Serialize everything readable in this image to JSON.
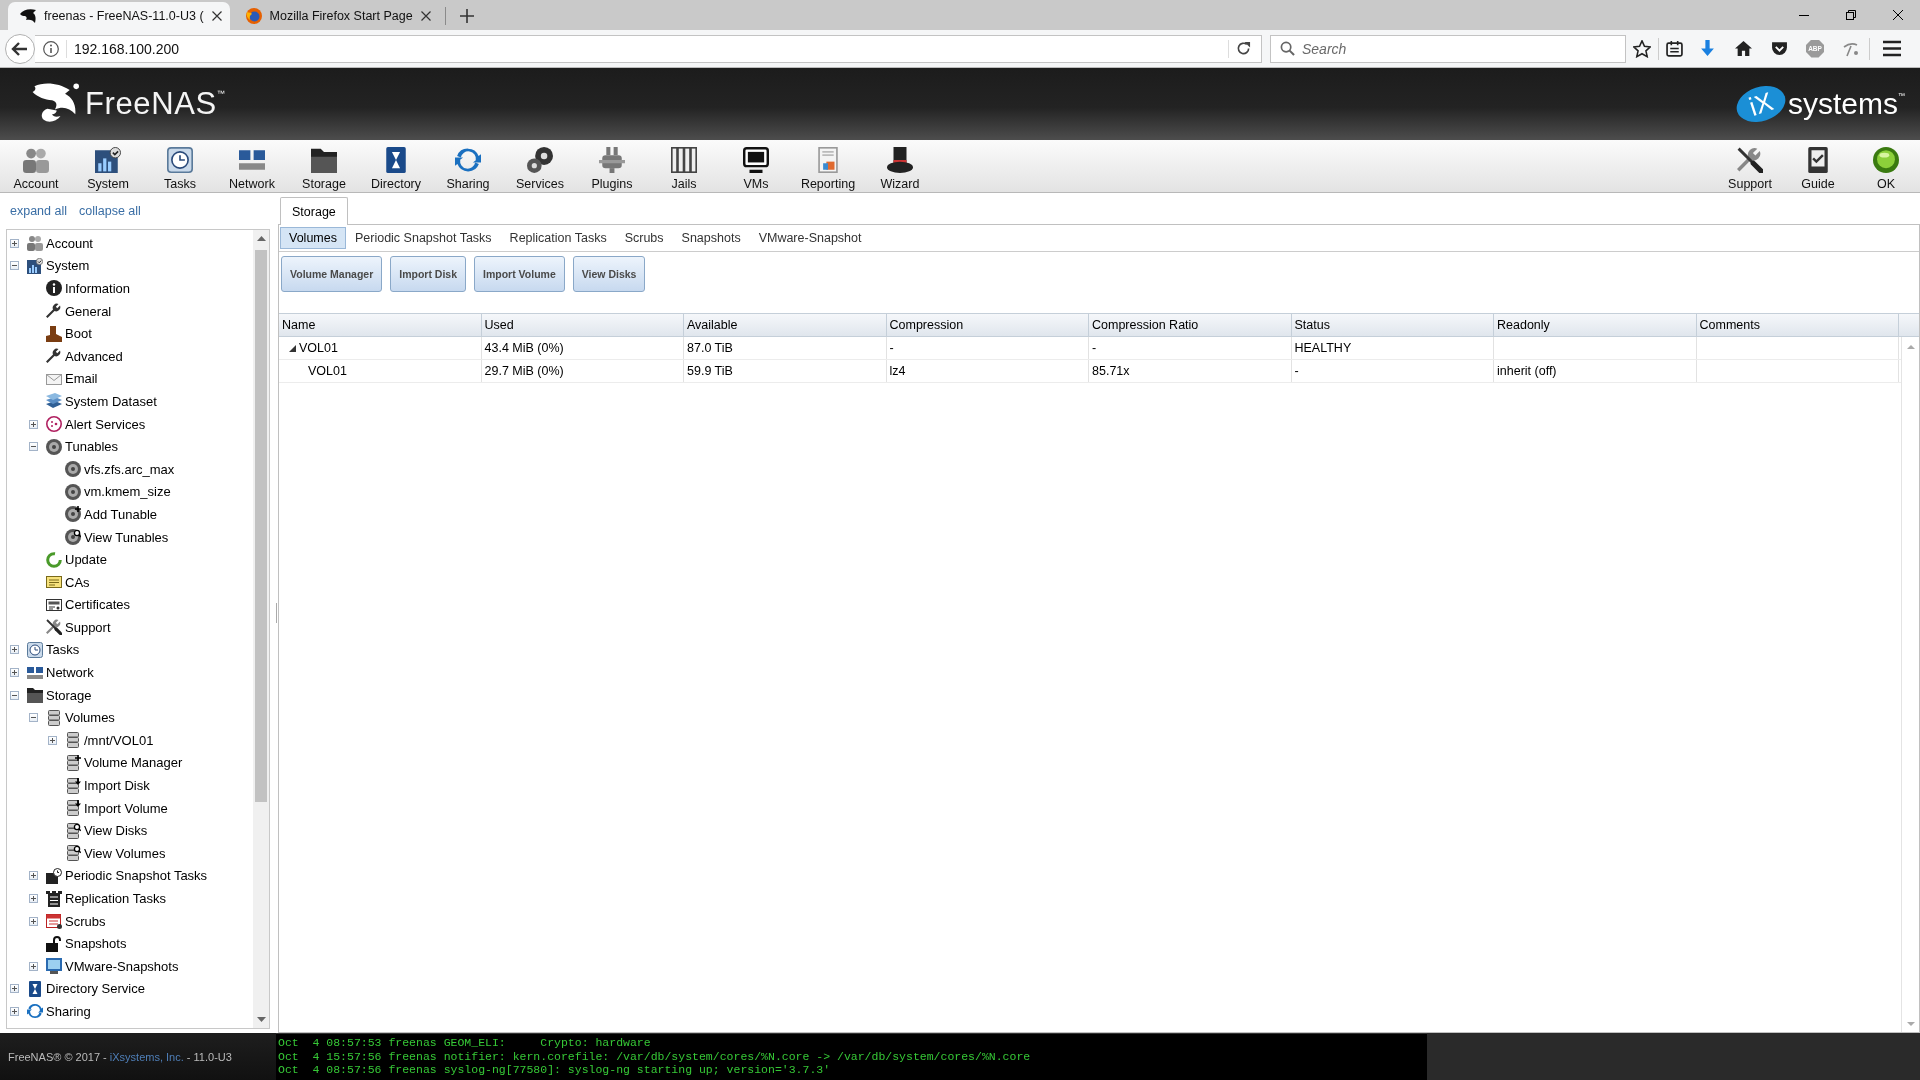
{
  "browser": {
    "tabs": [
      {
        "title": "freenas - FreeNAS-11.0-U3 (",
        "selected": true
      },
      {
        "title": "Mozilla Firefox Start Page",
        "selected": false
      }
    ],
    "address": "192.168.100.200",
    "search": {
      "placeholder": "Search"
    },
    "extension_label": "ABP"
  },
  "header": {
    "logo": "FreeNAS$^{™}$",
    "vendor": {
      "badge": "iX",
      "name": "systems$^{™}$"
    }
  },
  "toolbar": {
    "items": [
      {
        "label": "Account",
        "kind": "account"
      },
      {
        "label": "System",
        "kind": "system"
      },
      {
        "label": "Tasks",
        "kind": "tasks"
      },
      {
        "label": "Network",
        "kind": "network"
      },
      {
        "label": "Storage",
        "kind": "storage"
      },
      {
        "label": "Directory",
        "kind": "directory"
      },
      {
        "label": "Sharing",
        "kind": "sharing"
      },
      {
        "label": "Services",
        "kind": "services"
      },
      {
        "label": "Plugins",
        "kind": "plugins"
      },
      {
        "label": "Jails",
        "kind": "jails"
      },
      {
        "label": "VMs",
        "kind": "vms"
      },
      {
        "label": "Reporting",
        "kind": "reporting"
      },
      {
        "label": "Wizard",
        "kind": "wizard"
      }
    ],
    "right_items": [
      {
        "label": "Support",
        "kind": "support"
      },
      {
        "label": "Guide",
        "kind": "guide"
      },
      {
        "label": "OK",
        "kind": "ok"
      }
    ]
  },
  "sidebar": {
    "links": [
      "expand all",
      "collapse all"
    ],
    "tree": [
      {
        "label": "Account",
        "kind": "account",
        "expanded": false
      },
      {
        "label": "System",
        "kind": "system",
        "expanded": true,
        "children": [
          {
            "label": "Information",
            "kind": "info"
          },
          {
            "label": "General",
            "kind": "wrench"
          },
          {
            "label": "Boot",
            "kind": "boot"
          },
          {
            "label": "Advanced",
            "kind": "wrench"
          },
          {
            "label": "Email",
            "kind": "email"
          },
          {
            "label": "System Dataset",
            "kind": "dataset"
          },
          {
            "label": "Alert Services",
            "kind": "alert",
            "expanded": false
          },
          {
            "label": "Tunables",
            "kind": "tunable",
            "expanded": true,
            "children": [
              {
                "label": "vfs.zfs.arc_max",
                "kind": "tunable"
              },
              {
                "label": "vm.kmem_size",
                "kind": "tunable"
              },
              {
                "label": "Add Tunable",
                "kind": "tunableadd"
              },
              {
                "label": "View Tunables",
                "kind": "tunableview"
              }
            ]
          },
          {
            "label": "Update",
            "kind": "update"
          },
          {
            "label": "CAs",
            "kind": "ca"
          },
          {
            "label": "Certificates",
            "kind": "certificate"
          },
          {
            "label": "Support",
            "kind": "support"
          }
        ]
      },
      {
        "label": "Tasks",
        "kind": "tasks",
        "expanded": false
      },
      {
        "label": "Network",
        "kind": "network",
        "expanded": false
      },
      {
        "label": "Storage",
        "kind": "storage",
        "expanded": true,
        "children": [
          {
            "label": "Volumes",
            "kind": "disk",
            "expanded": true,
            "children": [
              {
                "label": "/mnt/VOL01",
                "kind": "disk",
                "expanded": false
              },
              {
                "label": "Volume Manager",
                "kind": "diskadd"
              },
              {
                "label": "Import Disk",
                "kind": "diskimport"
              },
              {
                "label": "Import Volume",
                "kind": "diskimport"
              },
              {
                "label": "View Disks",
                "kind": "diskview"
              },
              {
                "label": "View Volumes",
                "kind": "diskview"
              }
            ]
          },
          {
            "label": "Periodic Snapshot Tasks",
            "kind": "snaptask",
            "expanded": false
          },
          {
            "label": "Replication Tasks",
            "kind": "replication",
            "expanded": false
          },
          {
            "label": "Scrubs",
            "kind": "scrub",
            "expanded": false
          },
          {
            "label": "Snapshots",
            "kind": "snapshot"
          },
          {
            "label": "VMware-Snapshots",
            "kind": "vmware",
            "expanded": false
          }
        ]
      },
      {
        "label": "Directory Service",
        "kind": "directory",
        "expanded": false
      },
      {
        "label": "Sharing",
        "kind": "sharing",
        "expanded": false
      }
    ]
  },
  "content": {
    "tabs": [
      {
        "label": "Storage",
        "selected": true
      }
    ],
    "subtabs": [
      {
        "label": "Volumes",
        "selected": true
      },
      {
        "label": "Periodic Snapshot Tasks",
        "selected": false
      },
      {
        "label": "Replication Tasks",
        "selected": false
      },
      {
        "label": "Scrubs",
        "selected": false
      },
      {
        "label": "Snapshots",
        "selected": false
      },
      {
        "label": "VMware-Snapshot",
        "selected": false
      }
    ],
    "buttons": [
      "Volume Manager",
      "Import Disk",
      "Import Volume",
      "View Disks"
    ],
    "table": {
      "columns": [
        "Name",
        "Used",
        "Available",
        "Compression",
        "Compression Ratio",
        "Status",
        "Readonly",
        "Comments"
      ],
      "rows": [
        {
          "cells": [
            "VOL01",
            "43.4 MiB (0%)",
            "87.0 TiB",
            "-",
            "-",
            "HEALTHY",
            null,
            null
          ],
          "expanded": true,
          "children": [
            {
              "cells": [
                "VOL01",
                "29.7 MiB (0%)",
                "59.9 TiB",
                "lz4",
                "85.71x",
                "-",
                "inherit (off)",
                null
              ]
            }
          ]
        }
      ]
    }
  },
  "footer": {
    "copyright": "FreeNAS® © 2017 - ",
    "link": "iXsystems, Inc.",
    "version": " - 11.0-U3",
    "console": [
      "Oct  4 08:57:53 freenas GEOM_ELI:     Crypto: hardware",
      "Oct  4 15:57:56 freenas notifier: kern.corefile: /var/db/system/cores/%N.core -> /var/db/system/cores/%N.core",
      "Oct  4 08:57:56 freenas syslog-ng[77580]: syslog-ng starting up; version='3.7.3'"
    ]
  }
}
